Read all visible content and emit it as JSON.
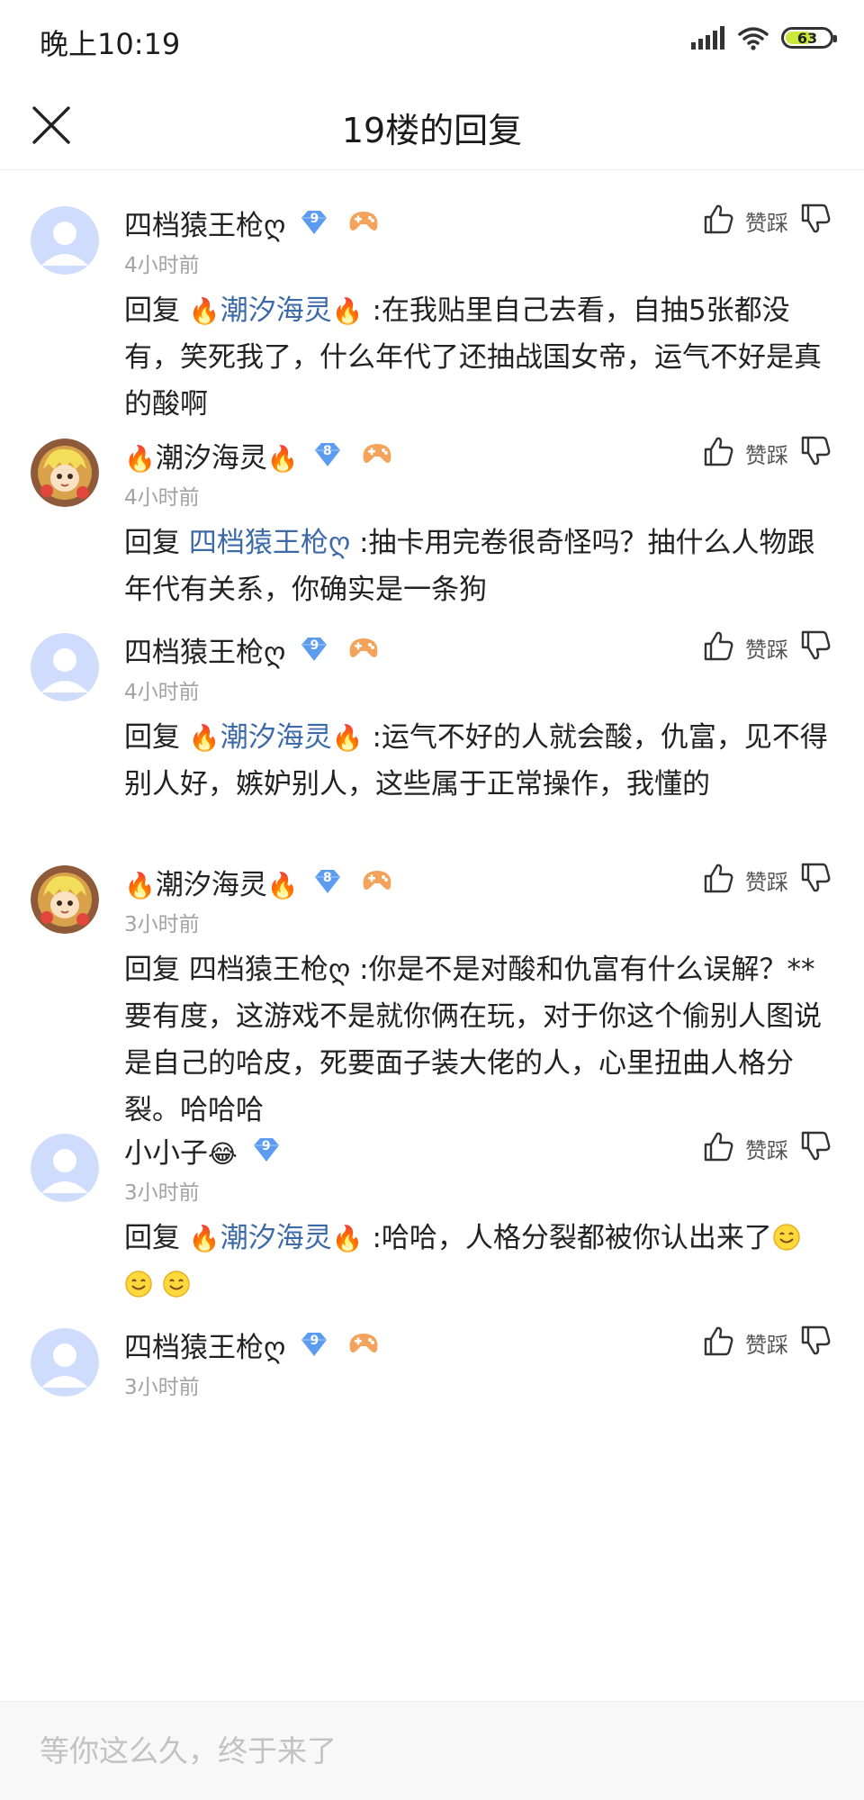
{
  "status": {
    "time": "晚上10:19",
    "battery": "63",
    "battery_level": 0.63
  },
  "header": {
    "title": "19楼的回复"
  },
  "comments": [
    {
      "user": "四档猿王枪ღ",
      "user_pre": "",
      "user_post": "",
      "gem_level": "9",
      "time": "4小时前",
      "reply_prefix": "回复 ",
      "mention_pre": "🔥",
      "mention": "潮汐海灵",
      "mention_post": "🔥",
      "text": " :在我贴里自己去看，自抽5张都没有，笑死我了，什么年代了还抽战国女帝，运气不好是真的酸啊",
      "vote_label": "赞踩"
    },
    {
      "user": "潮汐海灵",
      "user_pre": "🔥",
      "user_post": "🔥",
      "gem_level": "8",
      "time": "4小时前",
      "reply_prefix": "回复 ",
      "mention_pre": "",
      "mention": "四档猿王枪ღ",
      "mention_post": "",
      "text": " :抽卡用完卷很奇怪吗？抽什么人物跟年代有关系，你确实是一条狗",
      "vote_label": "赞踩"
    },
    {
      "user": "四档猿王枪ღ",
      "user_pre": "",
      "user_post": "",
      "gem_level": "9",
      "time": "4小时前",
      "reply_prefix": "回复 ",
      "mention_pre": "🔥",
      "mention": "潮汐海灵",
      "mention_post": "🔥",
      "text": " :运气不好的人就会酸，仇富，见不得别人好，嫉妒别人，这些属于正常操作，我懂的",
      "vote_label": "赞踩"
    },
    {
      "user": "潮汐海灵",
      "user_pre": "🔥",
      "user_post": "🔥",
      "gem_level": "8",
      "time": "3小时前",
      "reply_prefix": "回复 四档猿王枪ღ",
      "mention_pre": "",
      "mention": "",
      "mention_post": "",
      "text": " :你是不是对酸和仇富有什么误解？**要有度，这游戏不是就你俩在玩，对于你这个偷别人图说是自己的哈皮，死要面子装大佬的人，心里扭曲人格分裂。哈哈哈",
      "vote_label": "赞踩"
    },
    {
      "user": "小小子",
      "user_pre": "",
      "user_post": "😂",
      "gem_level": "9",
      "time": "3小时前",
      "reply_prefix": "回复 ",
      "mention_pre": "🔥",
      "mention": "潮汐海灵",
      "mention_post": "🔥",
      "text": " :哈哈，人格分裂都被你认出来了",
      "vote_label": "赞踩"
    },
    {
      "user": "四档猿王枪ღ",
      "user_pre": "",
      "user_post": "",
      "gem_level": "9",
      "time": "3小时前",
      "reply_prefix": "",
      "mention_pre": "",
      "mention": "",
      "mention_post": "",
      "text": "",
      "vote_label": "赞踩"
    }
  ],
  "reply_input": {
    "placeholder": "等你这么久，终于来了"
  },
  "colors": {
    "mention": "#3c6aa8",
    "gem": "#5b9cf0",
    "timestamp": "#a3a3a3"
  }
}
